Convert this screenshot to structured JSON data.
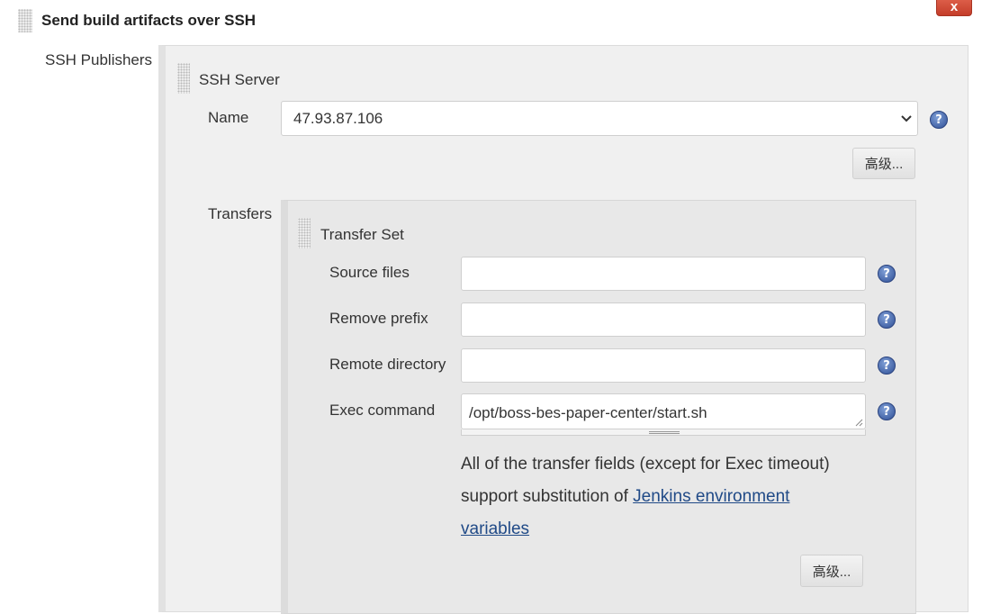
{
  "header": {
    "title": "Send build artifacts over SSH",
    "close_label": "x"
  },
  "ssh_publishers": {
    "label": "SSH Publishers",
    "server": {
      "section_title": "SSH Server",
      "name_label": "Name",
      "name_value": "47.93.87.106",
      "advanced_label": "高级..."
    },
    "transfers": {
      "label": "Transfers",
      "transfer_set": {
        "section_title": "Transfer Set",
        "fields": [
          {
            "label": "Source files",
            "value": ""
          },
          {
            "label": "Remove prefix",
            "value": ""
          },
          {
            "label": "Remote directory",
            "value": ""
          },
          {
            "label": "Exec command",
            "value": "/opt/boss-bes-paper-center/start.sh"
          }
        ],
        "note_text": "All of the transfer fields (except for Exec timeout) support substitution of ",
        "note_link": "Jenkins environment variables",
        "advanced_label": "高级..."
      }
    }
  },
  "colors": {
    "panel_bg": "#f0f0f0",
    "inner_panel_bg": "#e8e8e8",
    "close_red": "#d24b37",
    "help_blue": "#2f4f96",
    "link": "#204a87"
  },
  "icons": [
    "drag-handle-icon",
    "help-icon",
    "close-icon",
    "chevron-down-icon"
  ]
}
